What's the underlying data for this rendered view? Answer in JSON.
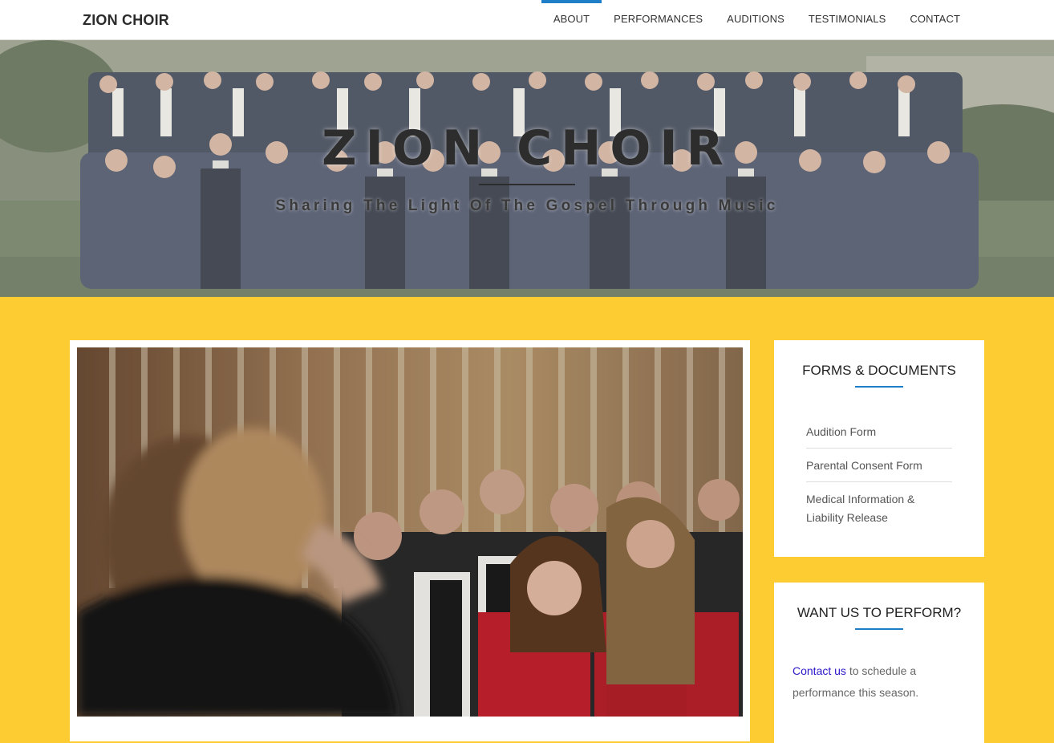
{
  "header": {
    "brand": "ZION CHOIR",
    "nav": [
      {
        "label": "ABOUT",
        "active": true
      },
      {
        "label": "PERFORMANCES",
        "active": false
      },
      {
        "label": "AUDITIONS",
        "active": false
      },
      {
        "label": "TESTIMONIALS",
        "active": false
      },
      {
        "label": "CONTACT",
        "active": false
      }
    ]
  },
  "hero": {
    "title": "ZION CHOIR",
    "subtitle": "Sharing The Light Of The Gospel Through Music"
  },
  "sidebar": {
    "forms": {
      "title": "FORMS & DOCUMENTS",
      "items": [
        "Audition Form",
        "Parental Consent Form",
        "Medical Information & Liability Release"
      ]
    },
    "perform": {
      "title": "WANT US TO PERFORM?",
      "link": "Contact us",
      "text": " to schedule a performance this season."
    }
  },
  "colors": {
    "accent": "#1e7ec8",
    "background": "#fdcc33",
    "link": "#2a17c9"
  }
}
